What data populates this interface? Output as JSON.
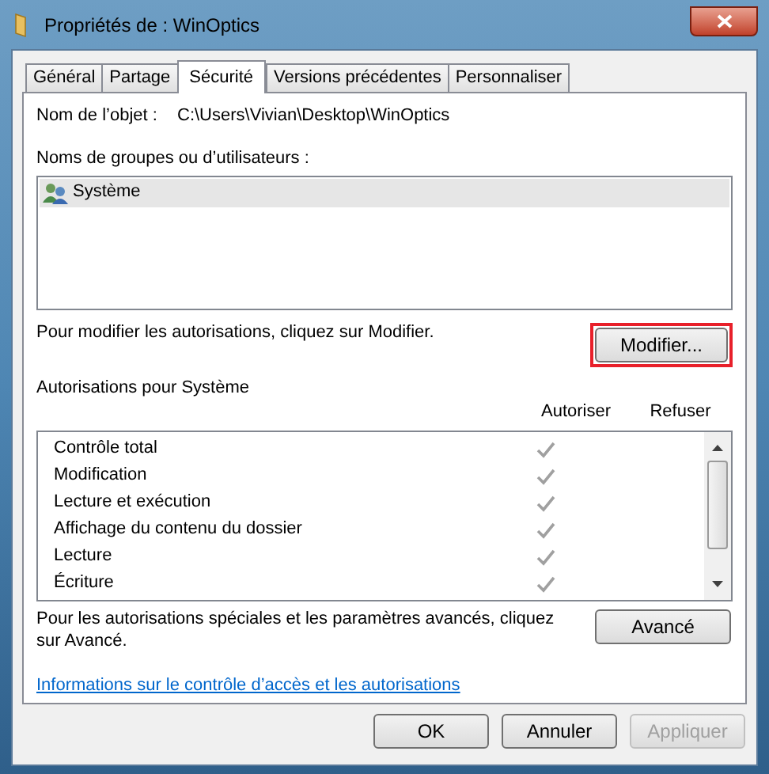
{
  "window": {
    "title": "Propriétés de : WinOptics"
  },
  "tabs": [
    {
      "label": "Général",
      "selected": false
    },
    {
      "label": "Partage",
      "selected": false
    },
    {
      "label": "Sécurité",
      "selected": true
    },
    {
      "label": "Versions précédentes",
      "selected": false
    },
    {
      "label": "Personnaliser",
      "selected": false
    }
  ],
  "object_name": {
    "label": "Nom de l’objet :",
    "value": "C:\\Users\\Vivian\\Desktop\\WinOptics"
  },
  "groups": {
    "label": "Noms de groupes ou d’utilisateurs :",
    "items": [
      {
        "name": "Système",
        "selected": true
      }
    ]
  },
  "modify": {
    "text": "Pour modifier les autorisations, cliquez sur Modifier.",
    "button": "Modifier...",
    "highlighted": true
  },
  "permissions": {
    "title": "Autorisations pour Système",
    "columns": [
      "Autoriser",
      "Refuser"
    ],
    "rows": [
      {
        "name": "Contrôle total",
        "allow": true,
        "deny": false
      },
      {
        "name": "Modification",
        "allow": true,
        "deny": false
      },
      {
        "name": "Lecture et exécution",
        "allow": true,
        "deny": false
      },
      {
        "name": "Affichage du contenu du dossier",
        "allow": true,
        "deny": false
      },
      {
        "name": "Lecture",
        "allow": true,
        "deny": false
      },
      {
        "name": "Écriture",
        "allow": true,
        "deny": false
      }
    ]
  },
  "advanced": {
    "text": "Pour les autorisations spéciales et les paramètres avancés, cliquez sur Avancé.",
    "button": "Avancé"
  },
  "link": "Informations sur le contrôle d’accès et les autorisations",
  "buttons": [
    {
      "label": "OK",
      "disabled": false
    },
    {
      "label": "Annuler",
      "disabled": false
    },
    {
      "label": "Appliquer",
      "disabled": true
    }
  ]
}
